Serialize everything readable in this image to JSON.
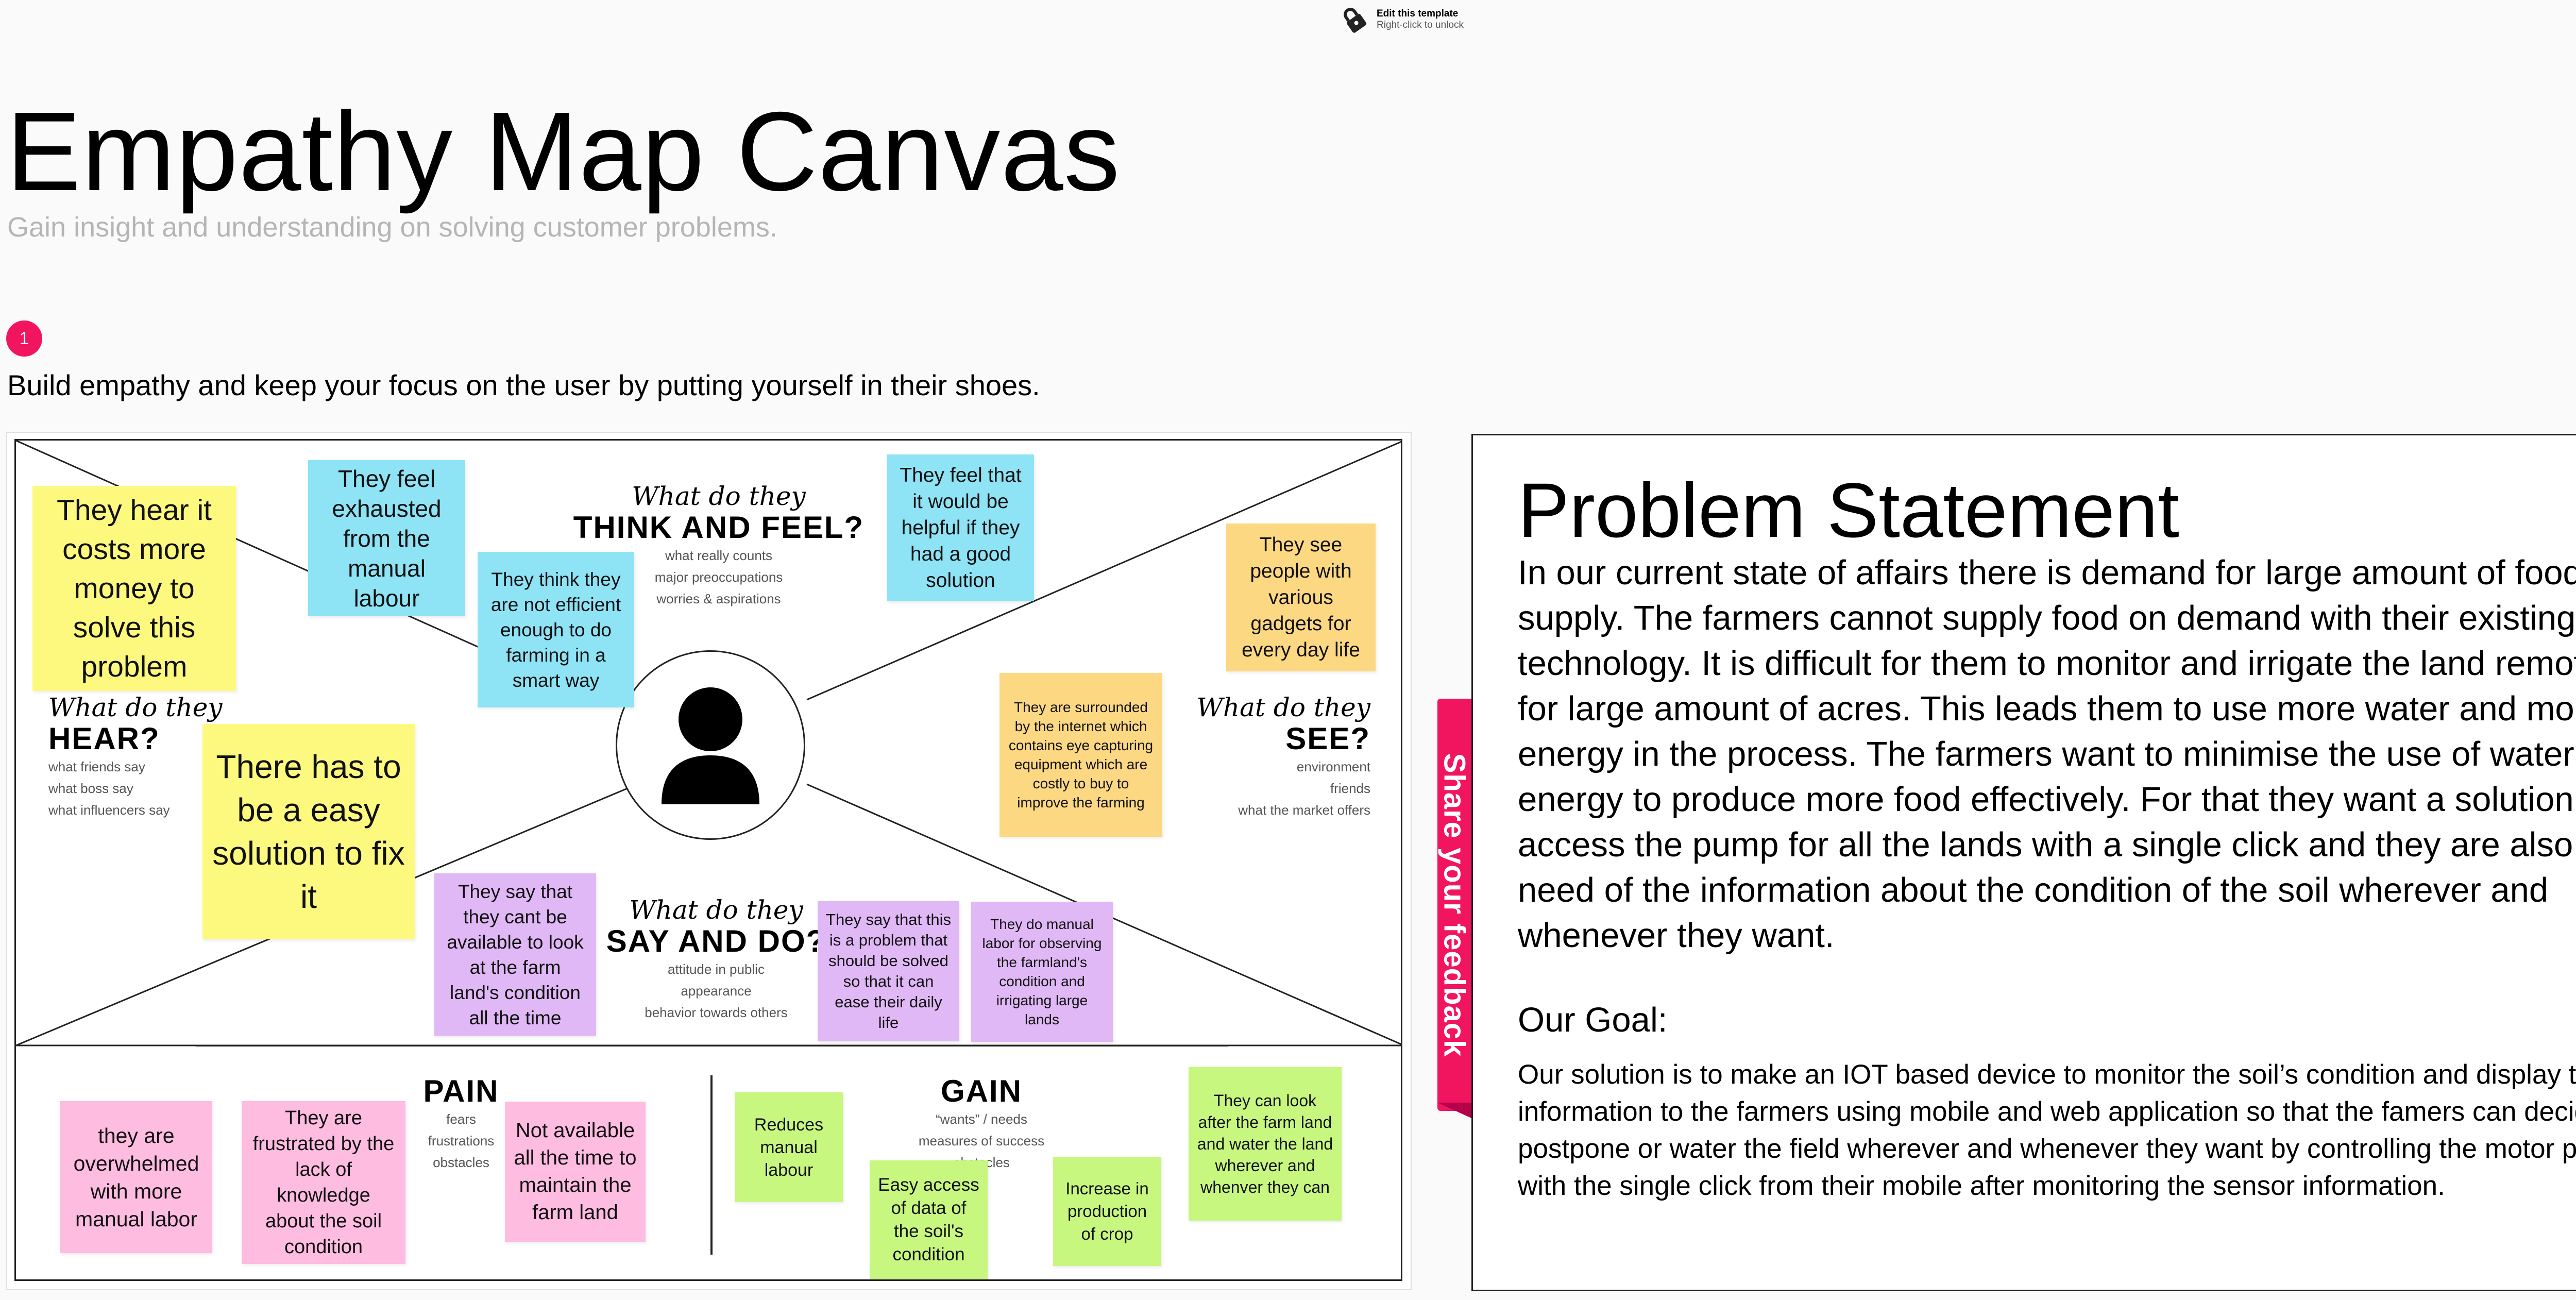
{
  "header": {
    "lock_title": "Edit this template",
    "lock_subtitle": "Right-click to unlock",
    "lock_icon": "lock-icon"
  },
  "page": {
    "title": "Empathy Map Canvas",
    "subtitle": "Gain insight and understanding on solving customer problems.",
    "step_number": "1",
    "instruction": "Build empathy and keep your focus on the user by putting yourself in their shoes."
  },
  "quadrants": {
    "think": {
      "script": "What do they",
      "caps": "THINK AND FEEL?",
      "hints": [
        "what really counts",
        "major preoccupations",
        "worries & aspirations"
      ]
    },
    "hear": {
      "script": "What do they",
      "caps": "HEAR?",
      "hints": [
        "what friends say",
        "what boss say",
        "what influencers say"
      ]
    },
    "see": {
      "script": "What do they",
      "caps": "SEE?",
      "hints": [
        "environment",
        "friends",
        "what the market offers"
      ]
    },
    "say": {
      "script": "What do they",
      "caps": "SAY AND DO?",
      "hints": [
        "attitude in public",
        "appearance",
        "behavior towards others"
      ]
    },
    "pain": {
      "caps": "PAIN",
      "hints": [
        "fears",
        "frustrations",
        "obstacles"
      ]
    },
    "gain": {
      "caps": "GAIN",
      "hints": [
        "“wants” / needs",
        "measures of success",
        "obstacles"
      ]
    }
  },
  "stickies": {
    "hear1": "They hear it costs more money to solve this problem",
    "hear2": "There has to be a easy solution to fix it",
    "think1": "They feel exhausted from the manual labour",
    "think2": "They think they are not efficient enough to do farming in a smart way",
    "think3": "They feel that it would be helpful if they had a good solution",
    "see1": "They see people with various gadgets for every day life",
    "see2": "They are surrounded by the internet which contains eye capturing equipment which are costly to buy to improve the farming",
    "say1": "They say that they cant be available to look at the farm land's condition all the time",
    "say2": "They say that this is a problem that should be solved so that it can ease their daily life",
    "say3": "They do manual labor for observing the farmland's condition and irrigating large lands",
    "pain1": "they are overwhelmed with more manual labor",
    "pain2": "They are frustrated by the lack of knowledge about the soil condition",
    "pain3": "Not available all the time to maintain the farm land",
    "gain1": "Reduces manual labour",
    "gain2": "Easy access of data of the soil's condition",
    "gain3": "Increase in production of crop",
    "gain4": "They can look after the farm land and water the land wherever and whenver they can"
  },
  "problem": {
    "title": "Problem Statement",
    "body": "In our current state of affairs there is demand for large amount of food supply. The farmers cannot supply food on demand with their existing technology. It is difficult for them to monitor and irrigate the land remotely for large amount of acres. This leads them to use more water and more energy in the process. The farmers want to minimise the use of water and energy to produce more food effectively. For that they want a solution to access the pump for all the lands with a single click and they are also in need of the information about the condition of the soil wherever and whenever they want.",
    "goal_title": "Our Goal:",
    "goal_body": "Our solution is to make an IOT based device to monitor the soil’s condition and display the information to the farmers using mobile and web application so that the famers can decide to postpone or water the field wherever and whenever they want by controlling the motor pumps with the single click from their mobile after monitoring the sensor information."
  },
  "feedback": {
    "label": "Share your feedback"
  },
  "colors": {
    "accent": "#f1155f",
    "yellow": "#fdf97f",
    "blue": "#8ee3f5",
    "orange": "#fdd882",
    "purple": "#e0b8f5",
    "pink": "#fdbce0",
    "green": "#c8f780"
  },
  "icons": {
    "avatar": "user-avatar-icon"
  }
}
